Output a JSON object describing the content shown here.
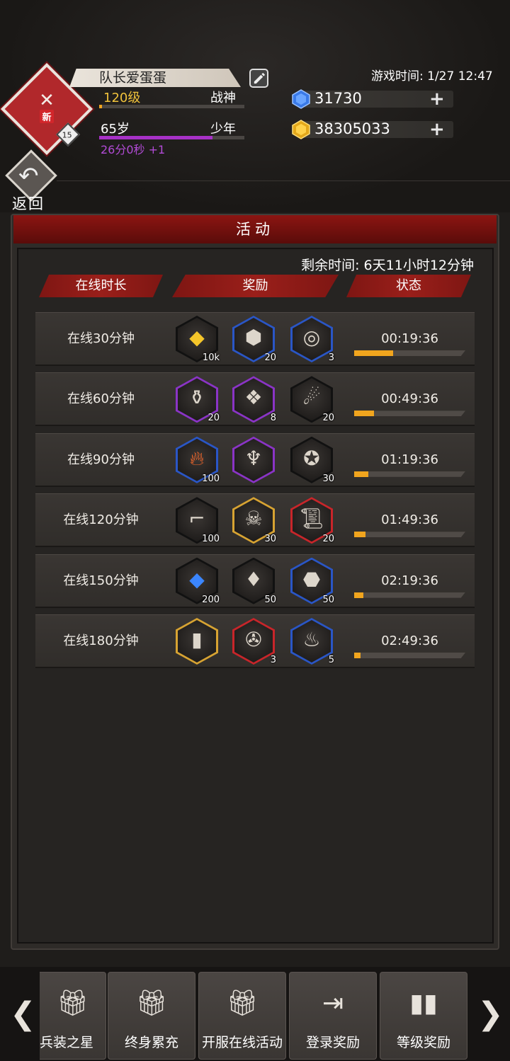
{
  "profile": {
    "name": "队长爱蛋蛋",
    "level": "120级",
    "title": "战神",
    "age": "65岁",
    "stage": "少年",
    "age_timer": "26分0秒 +1",
    "badge_number": "15",
    "new_tag": "新",
    "level_progress": 0.02,
    "age_progress": 0.78
  },
  "game_time": "游戏时间: 1/27 12:47",
  "currencies": {
    "gems": "31730",
    "gold": "38305033"
  },
  "back_label": "返回",
  "activity": {
    "title": "活动",
    "remaining": "剩余时间: 6天11小时12分钟",
    "columns": {
      "online": "在线时长",
      "reward": "奖励",
      "status": "状态"
    },
    "rows": [
      {
        "label": "在线30分钟",
        "time": "00:19:36",
        "progress": 0.35,
        "rewards": [
          {
            "icon": "gold-gem-icon",
            "qty": "10k",
            "frame": "black"
          },
          {
            "icon": "ore-icon",
            "qty": "20",
            "frame": "blue"
          },
          {
            "icon": "compass-icon",
            "qty": "3",
            "frame": "blue"
          }
        ]
      },
      {
        "label": "在线60分钟",
        "time": "00:49:36",
        "progress": 0.18,
        "rewards": [
          {
            "icon": "bottle-icon",
            "qty": "20",
            "frame": "purple"
          },
          {
            "icon": "crystal-icon",
            "qty": "8",
            "frame": "purple"
          },
          {
            "icon": "claw-icon",
            "qty": "20",
            "frame": "black"
          }
        ]
      },
      {
        "label": "在线90分钟",
        "time": "01:19:36",
        "progress": 0.13,
        "rewards": [
          {
            "icon": "torch-icon",
            "qty": "100",
            "frame": "blue"
          },
          {
            "icon": "chalice-icon",
            "qty": "",
            "frame": "purple"
          },
          {
            "icon": "star-coin-icon",
            "qty": "30",
            "frame": "black"
          }
        ]
      },
      {
        "label": "在线120分钟",
        "time": "01:49:36",
        "progress": 0.1,
        "rewards": [
          {
            "icon": "gun-part-icon",
            "qty": "100",
            "frame": "black"
          },
          {
            "icon": "skull-icon",
            "qty": "30",
            "frame": "gold"
          },
          {
            "icon": "scroll-icon",
            "qty": "20",
            "frame": "red"
          }
        ]
      },
      {
        "label": "在线150分钟",
        "time": "02:19:36",
        "progress": 0.08,
        "rewards": [
          {
            "icon": "blue-gem-icon",
            "qty": "200",
            "frame": "black"
          },
          {
            "icon": "shard-icon",
            "qty": "50",
            "frame": "black"
          },
          {
            "icon": "rock-icon",
            "qty": "50",
            "frame": "blue"
          }
        ]
      },
      {
        "label": "在线180分钟",
        "time": "02:49:36",
        "progress": 0.06,
        "rewards": [
          {
            "icon": "banner-icon",
            "qty": "",
            "frame": "gold"
          },
          {
            "icon": "emblem-icon",
            "qty": "3",
            "frame": "red"
          },
          {
            "icon": "flame-icon",
            "qty": "5",
            "frame": "blue"
          }
        ]
      }
    ]
  },
  "nav": {
    "items": [
      {
        "label": "兵装之星",
        "icon": "gift-icon"
      },
      {
        "label": "终身累充",
        "icon": "gift-icon"
      },
      {
        "label": "开服在线活动",
        "icon": "gift-icon"
      },
      {
        "label": "登录奖励",
        "icon": "login-icon"
      },
      {
        "label": "等级奖励",
        "icon": "bar-chart-icon"
      }
    ]
  },
  "colors": {
    "accent_red": "#8c1512",
    "progress_orange": "#f1a51e",
    "age_purple": "#a731c7",
    "level_gold": "#f0c23b"
  }
}
